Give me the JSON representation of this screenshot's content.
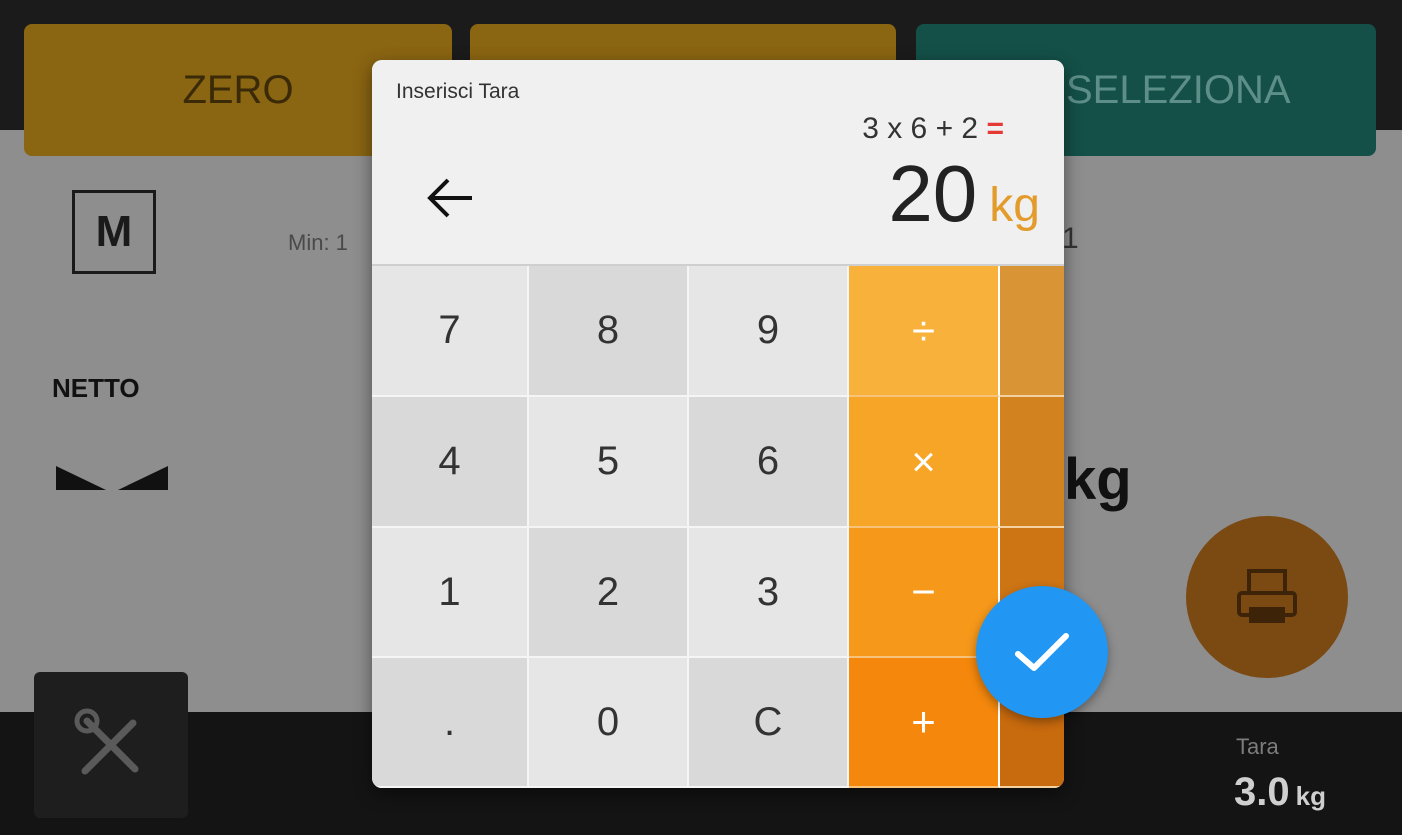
{
  "app": {
    "buttons": {
      "zero": "ZERO",
      "select": "SELEZIONA"
    },
    "m_indicator": "M",
    "min_label": "Min: 1",
    "netto": "NETTO",
    "weight_unit": "kg",
    "right_mark": "1",
    "tara_label": "Tara",
    "tara_value": "3.0",
    "tara_unit": "kg",
    "colors": {
      "zero_btn": "#8a6512",
      "select_btn": "#145048",
      "print_btn": "#7a4a12"
    },
    "icons": {
      "print": "printer-icon",
      "tools": "tools-icon",
      "stable": "stability-icon"
    }
  },
  "dialog": {
    "title": "Inserisci Tara",
    "expression": "3 x 6 + 2",
    "equals": "=",
    "result": "20",
    "unit": "kg",
    "back_icon": "arrow-left-icon",
    "keys": {
      "k7": "7",
      "k8": "8",
      "k9": "9",
      "div": "÷",
      "k4": "4",
      "k5": "5",
      "k6": "6",
      "mul": "×",
      "k1": "1",
      "k2": "2",
      "k3": "3",
      "sub": "−",
      "dot": ".",
      "k0": "0",
      "clear": "C",
      "add": "+"
    },
    "confirm_icon": "checkmark-icon",
    "colors": {
      "accent": "#e39b2b",
      "equals": "#e53935",
      "confirm": "#2196f3",
      "op_keys": "#f59e1a"
    }
  }
}
